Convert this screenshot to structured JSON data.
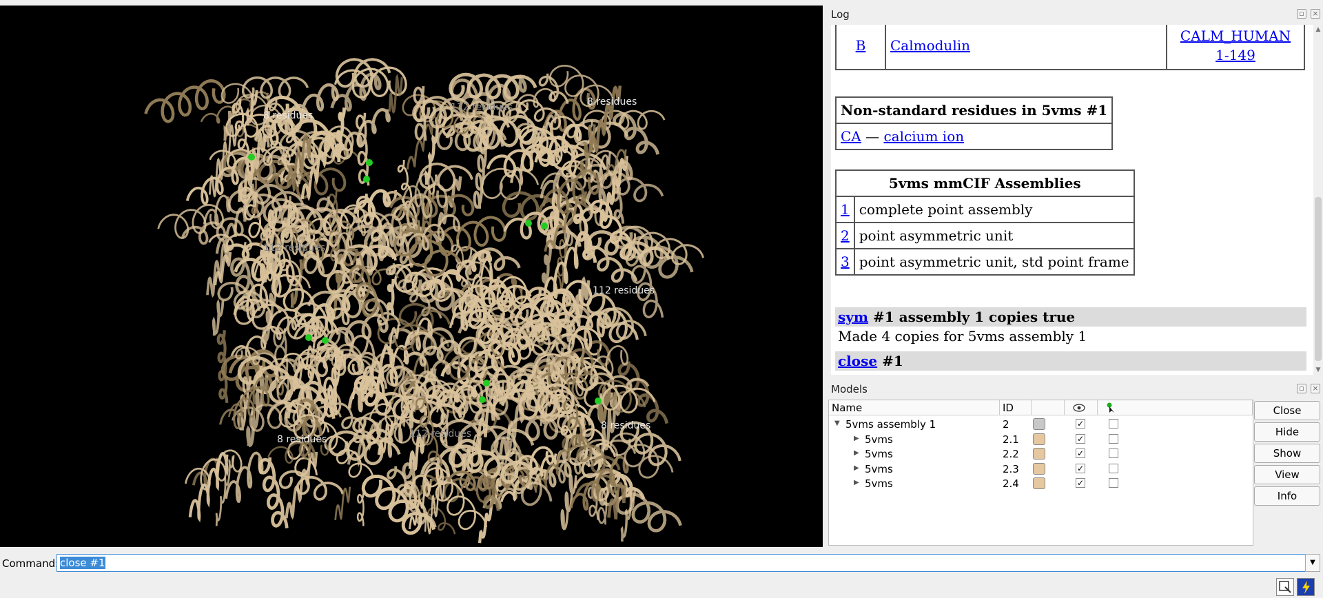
{
  "viewer": {
    "labels": [
      "8 residues",
      "112 residues",
      "8 residues",
      "112 residues",
      "112 residues",
      "8 residues",
      "112 residues",
      "8 residues"
    ]
  },
  "log": {
    "title": "Log",
    "chain_row": {
      "chain": "B",
      "description": "Calmodulin",
      "uniprot": "CALM_HUMAN",
      "range": "1-149"
    },
    "nonstd": {
      "header": "Non-standard residues in 5vms #1",
      "code": "CA",
      "dash": "—",
      "name": "calcium ion"
    },
    "assemblies": {
      "header": "5vms mmCIF Assemblies",
      "rows": [
        {
          "id": "1",
          "desc": "complete point assembly"
        },
        {
          "id": "2",
          "desc": "point asymmetric unit"
        },
        {
          "id": "3",
          "desc": "point asymmetric unit, std point frame"
        }
      ]
    },
    "cmd1": {
      "link": "sym",
      "rest": " #1 assembly 1 copies true"
    },
    "msg1": "Made 4 copies for 5vms assembly 1",
    "cmd2": {
      "link": "close",
      "rest": " #1"
    }
  },
  "models": {
    "title": "Models",
    "headers": {
      "name": "Name",
      "id": "ID"
    },
    "rows": [
      {
        "name": "5vms assembly 1",
        "id": "2",
        "color": "#c8c8c8",
        "shown": true,
        "selected": false
      },
      {
        "name": "5vms",
        "id": "2.1",
        "color": "#e6c8a0",
        "shown": true,
        "selected": false
      },
      {
        "name": "5vms",
        "id": "2.2",
        "color": "#e6c8a0",
        "shown": true,
        "selected": false
      },
      {
        "name": "5vms",
        "id": "2.3",
        "color": "#e6c8a0",
        "shown": true,
        "selected": false
      },
      {
        "name": "5vms",
        "id": "2.4",
        "color": "#e6c8a0",
        "shown": true,
        "selected": false
      }
    ],
    "buttons": [
      "Close",
      "Hide",
      "Show",
      "View",
      "Info"
    ]
  },
  "command": {
    "label": "Command:",
    "value": "close #1"
  },
  "colors": {
    "ribbon": "#d9c29b",
    "ion": "#22cc22",
    "accent": "#3b8bd8"
  }
}
